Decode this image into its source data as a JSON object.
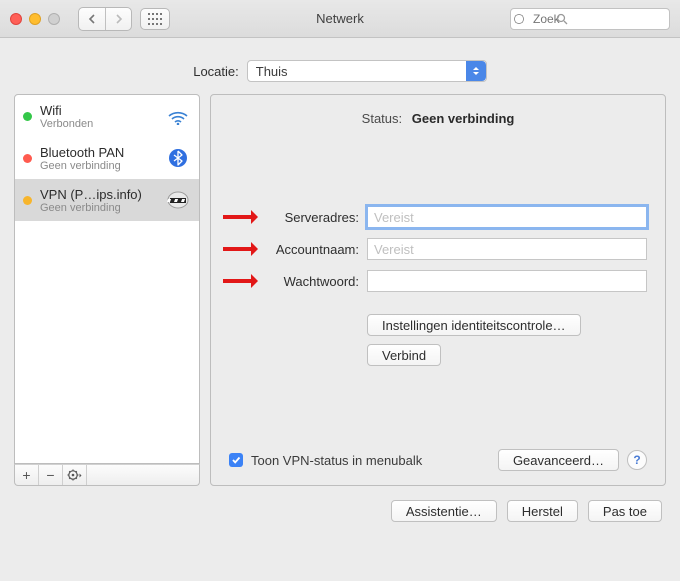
{
  "window": {
    "title": "Netwerk"
  },
  "search": {
    "placeholder": "Zoek"
  },
  "location": {
    "label": "Locatie:",
    "value": "Thuis"
  },
  "sidebar": {
    "items": [
      {
        "name": "Wifi",
        "sub": "Verbonden",
        "dot": "green"
      },
      {
        "name": "Bluetooth PAN",
        "sub": "Geen verbinding",
        "dot": "red"
      },
      {
        "name": "VPN (P…ips.info)",
        "sub": "Geen verbinding",
        "dot": "yellow"
      }
    ]
  },
  "details": {
    "status_label": "Status:",
    "status_value": "Geen verbinding",
    "server_label": "Serveradres:",
    "server_placeholder": "Vereist",
    "server_value": "",
    "account_label": "Accountnaam:",
    "account_placeholder": "Vereist",
    "account_value": "",
    "password_label": "Wachtwoord:",
    "password_value": "",
    "auth_btn": "Instellingen identiteitscontrole…",
    "connect_btn": "Verbind",
    "menubar_checkbox": "Toon VPN-status in menubalk",
    "menubar_checked": true,
    "advanced_btn": "Geavanceerd…"
  },
  "footer": {
    "assist": "Assistentie…",
    "revert": "Herstel",
    "apply": "Pas toe"
  },
  "icons": {
    "add": "+",
    "remove": "−",
    "gear": "✻"
  }
}
